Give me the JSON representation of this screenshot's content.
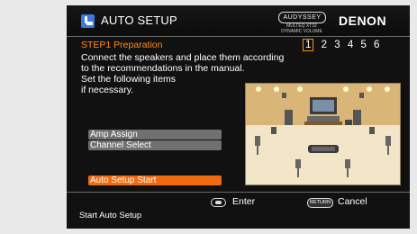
{
  "window": {
    "title": "AUTO SETUP",
    "logo_certification": "AUDYSSEY",
    "logo_certification_sub": "MULTEQ XT32 DYNAMIC VOLUME",
    "brand": "DENON"
  },
  "step": {
    "title": "STEP1 Preparation",
    "numbers": [
      "1",
      "2",
      "3",
      "4",
      "5",
      "6"
    ],
    "current_index": 0
  },
  "instructions": {
    "line1": "Connect the speakers and place them according",
    "line2": "to the recommendations in the manual.",
    "line3": "Set the following items",
    "line4": "if necessary."
  },
  "menu": {
    "amp_assign": "Amp Assign",
    "channel_select": "Channel Select",
    "auto_setup_start": "Auto Setup Start"
  },
  "footer": {
    "enter_label": "Enter",
    "return_key": "RETURN",
    "cancel_label": "Cancel",
    "status_text": "Start Auto Setup"
  },
  "illustration": {
    "name": "speaker-placement-room",
    "colors": {
      "floor": "#f3e5c7",
      "wall": "#d8b57a",
      "speaker": "#5a5a5a"
    }
  },
  "colors": {
    "accent": "#ff8a1e",
    "button_bg": "#707070",
    "selected_bg": "#f06a10",
    "panel_bg": "#111111"
  }
}
